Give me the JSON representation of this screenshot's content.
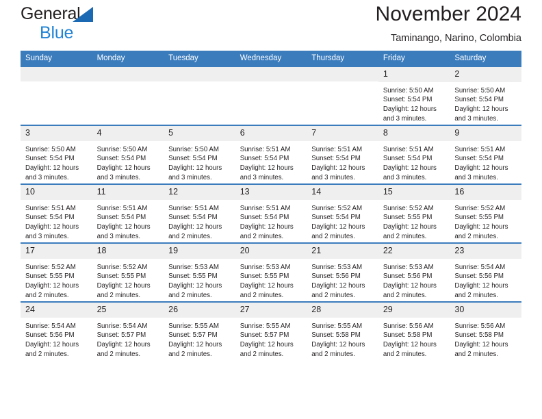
{
  "brand": {
    "name_part1": "General",
    "name_part2": "Blue",
    "triangle_color": "#1b69b2",
    "blue_color": "#1f83d6"
  },
  "header": {
    "title": "November 2024",
    "subtitle": "Taminango, Narino, Colombia"
  },
  "theme": {
    "header_blue": "#3b7cbd",
    "daynum_gray": "#efefef"
  },
  "weekday_headers": [
    "Sunday",
    "Monday",
    "Tuesday",
    "Wednesday",
    "Thursday",
    "Friday",
    "Saturday"
  ],
  "labels": {
    "sunrise_prefix": "Sunrise:",
    "sunset_prefix": "Sunset:",
    "daylight_prefix": "Daylight:"
  },
  "weeks": [
    [
      {
        "day": "",
        "empty": true
      },
      {
        "day": "",
        "empty": true
      },
      {
        "day": "",
        "empty": true
      },
      {
        "day": "",
        "empty": true
      },
      {
        "day": "",
        "empty": true
      },
      {
        "day": "1",
        "sunrise": "Sunrise: 5:50 AM",
        "sunset": "Sunset: 5:54 PM",
        "daylight": "Daylight: 12 hours and 3 minutes."
      },
      {
        "day": "2",
        "sunrise": "Sunrise: 5:50 AM",
        "sunset": "Sunset: 5:54 PM",
        "daylight": "Daylight: 12 hours and 3 minutes."
      }
    ],
    [
      {
        "day": "3",
        "sunrise": "Sunrise: 5:50 AM",
        "sunset": "Sunset: 5:54 PM",
        "daylight": "Daylight: 12 hours and 3 minutes."
      },
      {
        "day": "4",
        "sunrise": "Sunrise: 5:50 AM",
        "sunset": "Sunset: 5:54 PM",
        "daylight": "Daylight: 12 hours and 3 minutes."
      },
      {
        "day": "5",
        "sunrise": "Sunrise: 5:50 AM",
        "sunset": "Sunset: 5:54 PM",
        "daylight": "Daylight: 12 hours and 3 minutes."
      },
      {
        "day": "6",
        "sunrise": "Sunrise: 5:51 AM",
        "sunset": "Sunset: 5:54 PM",
        "daylight": "Daylight: 12 hours and 3 minutes."
      },
      {
        "day": "7",
        "sunrise": "Sunrise: 5:51 AM",
        "sunset": "Sunset: 5:54 PM",
        "daylight": "Daylight: 12 hours and 3 minutes."
      },
      {
        "day": "8",
        "sunrise": "Sunrise: 5:51 AM",
        "sunset": "Sunset: 5:54 PM",
        "daylight": "Daylight: 12 hours and 3 minutes."
      },
      {
        "day": "9",
        "sunrise": "Sunrise: 5:51 AM",
        "sunset": "Sunset: 5:54 PM",
        "daylight": "Daylight: 12 hours and 3 minutes."
      }
    ],
    [
      {
        "day": "10",
        "sunrise": "Sunrise: 5:51 AM",
        "sunset": "Sunset: 5:54 PM",
        "daylight": "Daylight: 12 hours and 3 minutes."
      },
      {
        "day": "11",
        "sunrise": "Sunrise: 5:51 AM",
        "sunset": "Sunset: 5:54 PM",
        "daylight": "Daylight: 12 hours and 3 minutes."
      },
      {
        "day": "12",
        "sunrise": "Sunrise: 5:51 AM",
        "sunset": "Sunset: 5:54 PM",
        "daylight": "Daylight: 12 hours and 2 minutes."
      },
      {
        "day": "13",
        "sunrise": "Sunrise: 5:51 AM",
        "sunset": "Sunset: 5:54 PM",
        "daylight": "Daylight: 12 hours and 2 minutes."
      },
      {
        "day": "14",
        "sunrise": "Sunrise: 5:52 AM",
        "sunset": "Sunset: 5:54 PM",
        "daylight": "Daylight: 12 hours and 2 minutes."
      },
      {
        "day": "15",
        "sunrise": "Sunrise: 5:52 AM",
        "sunset": "Sunset: 5:55 PM",
        "daylight": "Daylight: 12 hours and 2 minutes."
      },
      {
        "day": "16",
        "sunrise": "Sunrise: 5:52 AM",
        "sunset": "Sunset: 5:55 PM",
        "daylight": "Daylight: 12 hours and 2 minutes."
      }
    ],
    [
      {
        "day": "17",
        "sunrise": "Sunrise: 5:52 AM",
        "sunset": "Sunset: 5:55 PM",
        "daylight": "Daylight: 12 hours and 2 minutes."
      },
      {
        "day": "18",
        "sunrise": "Sunrise: 5:52 AM",
        "sunset": "Sunset: 5:55 PM",
        "daylight": "Daylight: 12 hours and 2 minutes."
      },
      {
        "day": "19",
        "sunrise": "Sunrise: 5:53 AM",
        "sunset": "Sunset: 5:55 PM",
        "daylight": "Daylight: 12 hours and 2 minutes."
      },
      {
        "day": "20",
        "sunrise": "Sunrise: 5:53 AM",
        "sunset": "Sunset: 5:55 PM",
        "daylight": "Daylight: 12 hours and 2 minutes."
      },
      {
        "day": "21",
        "sunrise": "Sunrise: 5:53 AM",
        "sunset": "Sunset: 5:56 PM",
        "daylight": "Daylight: 12 hours and 2 minutes."
      },
      {
        "day": "22",
        "sunrise": "Sunrise: 5:53 AM",
        "sunset": "Sunset: 5:56 PM",
        "daylight": "Daylight: 12 hours and 2 minutes."
      },
      {
        "day": "23",
        "sunrise": "Sunrise: 5:54 AM",
        "sunset": "Sunset: 5:56 PM",
        "daylight": "Daylight: 12 hours and 2 minutes."
      }
    ],
    [
      {
        "day": "24",
        "sunrise": "Sunrise: 5:54 AM",
        "sunset": "Sunset: 5:56 PM",
        "daylight": "Daylight: 12 hours and 2 minutes."
      },
      {
        "day": "25",
        "sunrise": "Sunrise: 5:54 AM",
        "sunset": "Sunset: 5:57 PM",
        "daylight": "Daylight: 12 hours and 2 minutes."
      },
      {
        "day": "26",
        "sunrise": "Sunrise: 5:55 AM",
        "sunset": "Sunset: 5:57 PM",
        "daylight": "Daylight: 12 hours and 2 minutes."
      },
      {
        "day": "27",
        "sunrise": "Sunrise: 5:55 AM",
        "sunset": "Sunset: 5:57 PM",
        "daylight": "Daylight: 12 hours and 2 minutes."
      },
      {
        "day": "28",
        "sunrise": "Sunrise: 5:55 AM",
        "sunset": "Sunset: 5:58 PM",
        "daylight": "Daylight: 12 hours and 2 minutes."
      },
      {
        "day": "29",
        "sunrise": "Sunrise: 5:56 AM",
        "sunset": "Sunset: 5:58 PM",
        "daylight": "Daylight: 12 hours and 2 minutes."
      },
      {
        "day": "30",
        "sunrise": "Sunrise: 5:56 AM",
        "sunset": "Sunset: 5:58 PM",
        "daylight": "Daylight: 12 hours and 2 minutes."
      }
    ]
  ]
}
